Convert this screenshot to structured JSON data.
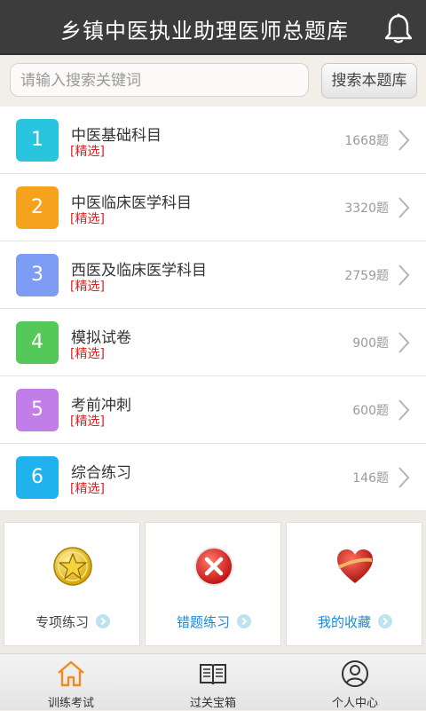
{
  "header": {
    "title": "乡镇中医执业助理医师总题库",
    "bell_icon": "bell-icon"
  },
  "search": {
    "placeholder": "请输入搜索关键词",
    "value": "",
    "button_label": "搜索本题库"
  },
  "subjects": [
    {
      "index": "1",
      "name": "中医基础科目",
      "tag": "[精选]",
      "count": "1668题",
      "color": "#29c4de"
    },
    {
      "index": "2",
      "name": "中医临床医学科目",
      "tag": "[精选]",
      "count": "3320题",
      "color": "#f5a31c"
    },
    {
      "index": "3",
      "name": "西医及临床医学科目",
      "tag": "[精选]",
      "count": "2759题",
      "color": "#7f9cf4"
    },
    {
      "index": "4",
      "name": "模拟试卷",
      "tag": "[精选]",
      "count": "900题",
      "color": "#55c85a"
    },
    {
      "index": "5",
      "name": "考前冲刺",
      "tag": "[精选]",
      "count": "600题",
      "color": "#c27ee8"
    },
    {
      "index": "6",
      "name": "综合练习",
      "tag": "[精选]",
      "count": "146题",
      "color": "#1fb2ef"
    }
  ],
  "cards": [
    {
      "label": "专项练习",
      "icon": "star-badge-icon",
      "color": "#444444"
    },
    {
      "label": "错题练习",
      "icon": "red-x-icon",
      "color": "#1c8ad6"
    },
    {
      "label": "我的收藏",
      "icon": "heart-icon",
      "color": "#1c8ad6"
    }
  ],
  "tabs": [
    {
      "label": "训练考试",
      "icon": "home-icon",
      "active": true,
      "active_color": "#f08a1c"
    },
    {
      "label": "过关宝箱",
      "icon": "book-icon",
      "active": false
    },
    {
      "label": "个人中心",
      "icon": "user-icon",
      "active": false
    }
  ]
}
